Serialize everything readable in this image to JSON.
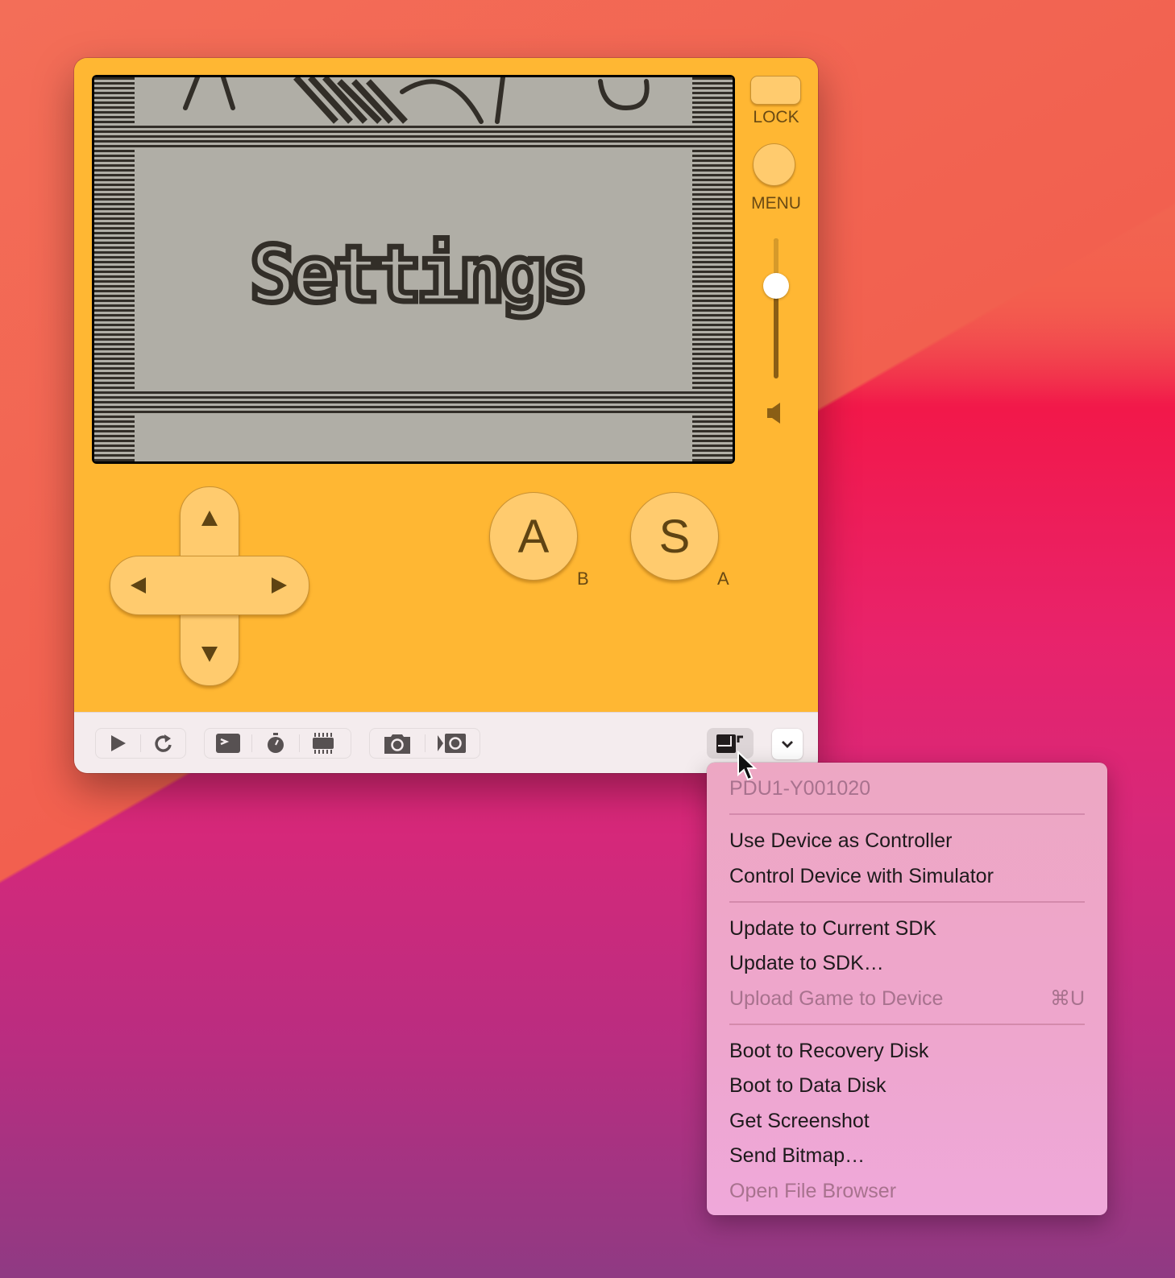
{
  "desktop": {
    "wallpaper_colors": [
      "#f06a55",
      "#f2184a",
      "#d6287a",
      "#8f3a83"
    ]
  },
  "simulator": {
    "body_color": "#ffb733",
    "button_color": "#ffcb6e",
    "screen": {
      "title_text": "Settings",
      "lcd_background": "#b0aea6",
      "lcd_ink": "#322e28"
    },
    "side_controls": {
      "lock_label": "LOCK",
      "menu_label": "MENU",
      "volume_level": 0.66
    },
    "buttons": {
      "left_label": "A",
      "left_sub_label": "B",
      "right_label": "S",
      "right_sub_label": "A"
    },
    "dpad": {
      "up": "up-arrow",
      "down": "down-arrow",
      "left": "left-arrow",
      "right": "right-arrow"
    }
  },
  "toolbar": {
    "groups": [
      {
        "items": [
          "play-icon",
          "reload-icon"
        ]
      },
      {
        "items": [
          "console-icon",
          "stopwatch-icon",
          "chip-icon"
        ]
      },
      {
        "items": [
          "camera-icon",
          "record-icon"
        ]
      }
    ],
    "device_button_icon": "device-icon",
    "menu_toggle_icon": "chevron-down-icon"
  },
  "device_menu": {
    "header": "PDU1-Y001020",
    "sections": [
      [
        {
          "label": "Use Device as Controller",
          "enabled": true
        },
        {
          "label": "Control Device with Simulator",
          "enabled": true
        }
      ],
      [
        {
          "label": "Update to Current SDK",
          "enabled": true
        },
        {
          "label": "Update to SDK…",
          "enabled": true
        },
        {
          "label": "Upload Game to Device",
          "enabled": false,
          "shortcut": "⌘U"
        }
      ],
      [
        {
          "label": "Boot to Recovery Disk",
          "enabled": true
        },
        {
          "label": "Boot to Data Disk",
          "enabled": true
        },
        {
          "label": "Get Screenshot",
          "enabled": true
        },
        {
          "label": "Send Bitmap…",
          "enabled": true
        },
        {
          "label": "Open File Browser",
          "enabled": false
        }
      ]
    ]
  }
}
